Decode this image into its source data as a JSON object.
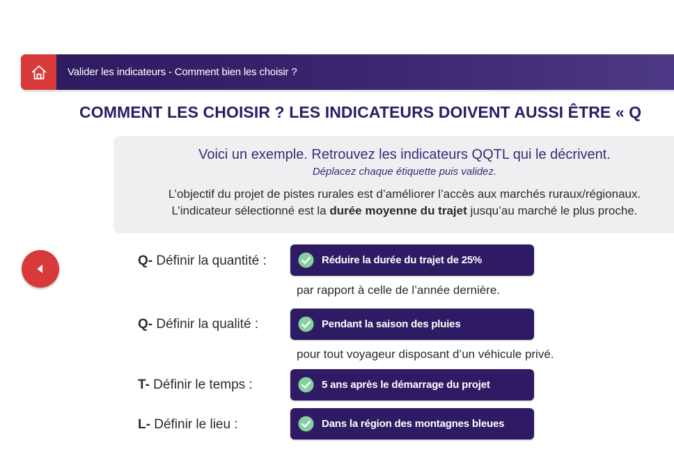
{
  "banner": {
    "title": "Valider les indicateurs - Comment bien les choisir ?"
  },
  "heading": {
    "text": "COMMENT LES CHOISIR ? LES INDICATEURS DOIVENT AUSSI  ÊTRE « Q"
  },
  "example": {
    "title": "Voici un exemple. Retrouvez les indicateurs QQTL qui le décrivent.",
    "hint": "Déplacez chaque étiquette puis validez.",
    "description_line1": "L’objectif du projet de pistes rurales est d’améliorer l’accès aux marchés ruraux/régionaux.",
    "description_line2_before": "L’indicateur sélectionné est la",
    "description_line2_bold": "durée moyenne du trajet",
    "description_line2_after": "jusqu’au marché le plus proche."
  },
  "rows": [
    {
      "letter": "Q-",
      "label": "Définir la quantité :",
      "chip": "Réduire la durée du trajet de 25%",
      "suffix": "par rapport à celle de l’année dernière."
    },
    {
      "letter": "Q-",
      "label": "Définir la qualité :",
      "chip": "Pendant la saison des pluies",
      "suffix": "pour tout voyageur disposant d’un véhicule privé."
    },
    {
      "letter": "T-",
      "label": "Définir le temps :",
      "chip": "5 ans après le démarrage du projet"
    },
    {
      "letter": "L-",
      "label": "Définir le lieu :",
      "chip": "Dans la région des montagnes bleues"
    }
  ],
  "icons": {
    "home": "home-icon",
    "back": "arrow-left-icon",
    "check": "check-circle-icon"
  },
  "colors": {
    "banner": "#2c1a5e",
    "accent_red": "#d8393b",
    "chip": "#2e1b63",
    "check_green": "#86cf9f",
    "heading": "#2e1a63",
    "card_bg": "#efeff1"
  }
}
